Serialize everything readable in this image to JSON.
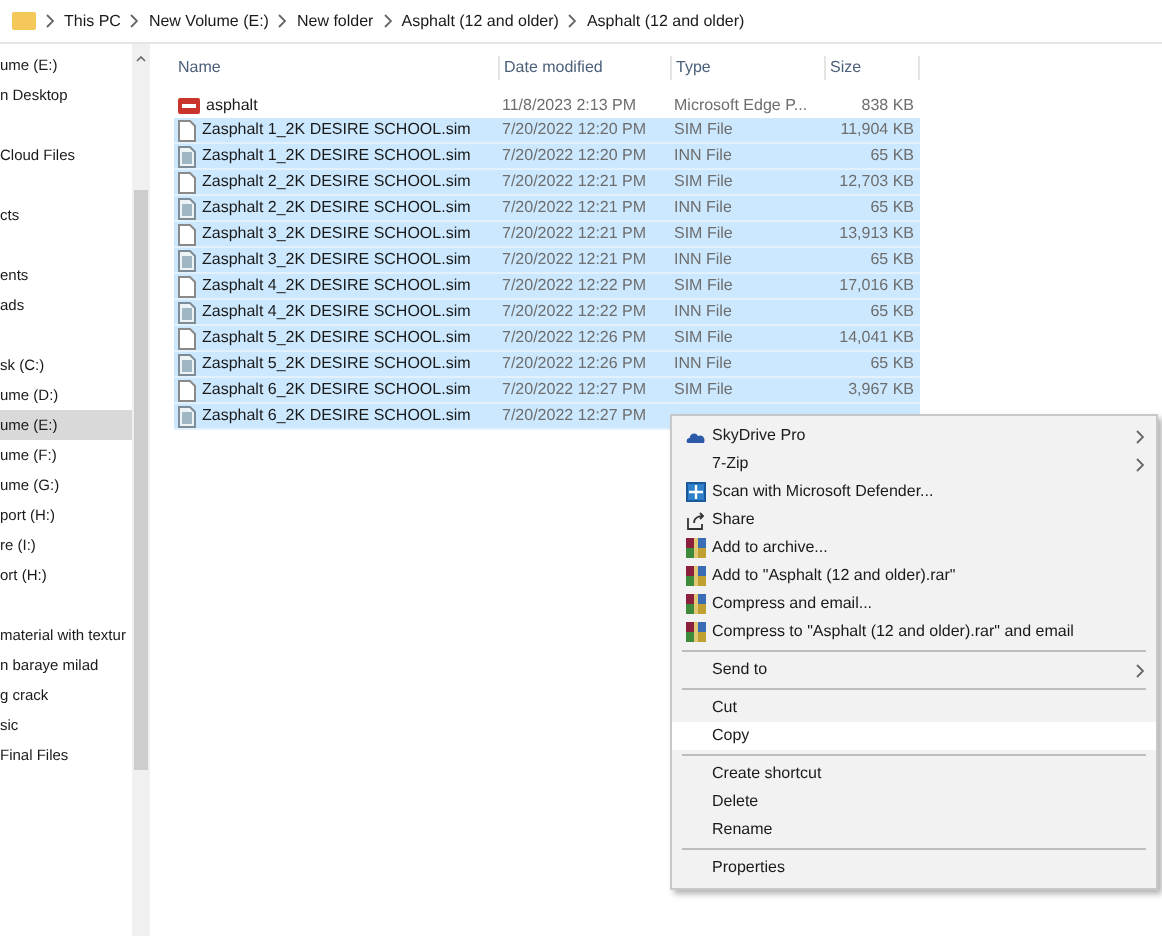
{
  "breadcrumb": [
    "This PC",
    "New Volume (E:)",
    "New folder",
    "Asphalt (12 and older)",
    "Asphalt (12 and older)"
  ],
  "sidebar": {
    "items": [
      {
        "label": "ume (E:)",
        "selected": false,
        "gap": false
      },
      {
        "label": "n Desktop",
        "selected": false,
        "gap": false
      },
      {
        "label": "Cloud Files",
        "selected": false,
        "gap": true
      },
      {
        "label": "cts",
        "selected": false,
        "gap": true
      },
      {
        "label": "ents",
        "selected": false,
        "gap": true
      },
      {
        "label": "ads",
        "selected": false,
        "gap": false
      },
      {
        "label": "sk (C:)",
        "selected": false,
        "gap": true
      },
      {
        "label": "ume (D:)",
        "selected": false,
        "gap": false
      },
      {
        "label": "ume (E:)",
        "selected": true,
        "gap": false
      },
      {
        "label": "ume (F:)",
        "selected": false,
        "gap": false
      },
      {
        "label": "ume (G:)",
        "selected": false,
        "gap": false
      },
      {
        "label": "port (H:)",
        "selected": false,
        "gap": false
      },
      {
        "label": "re (I:)",
        "selected": false,
        "gap": false
      },
      {
        "label": "ort (H:)",
        "selected": false,
        "gap": false
      },
      {
        "label": "material with textur",
        "selected": false,
        "gap": true
      },
      {
        "label": "n baraye milad",
        "selected": false,
        "gap": false
      },
      {
        "label": "g crack",
        "selected": false,
        "gap": false
      },
      {
        "label": "sic",
        "selected": false,
        "gap": false
      },
      {
        "label": "Final Files",
        "selected": false,
        "gap": false
      }
    ]
  },
  "table": {
    "columns": [
      "Name",
      "Date modified",
      "Type",
      "Size"
    ],
    "rows": [
      {
        "kind": "pdf",
        "name": "asphalt",
        "date": "11/8/2023 2:13 PM",
        "type": "Microsoft Edge P...",
        "size": "838 KB",
        "selected": false
      },
      {
        "kind": "sim",
        "name": "Zasphalt 1_2K DESIRE SCHOOL.sim",
        "date": "7/20/2022 12:20 PM",
        "type": "SIM File",
        "size": "11,904 KB",
        "selected": true
      },
      {
        "kind": "inn",
        "name": "Zasphalt 1_2K DESIRE SCHOOL.sim",
        "date": "7/20/2022 12:20 PM",
        "type": "INN File",
        "size": "65 KB",
        "selected": true
      },
      {
        "kind": "sim",
        "name": "Zasphalt 2_2K DESIRE SCHOOL.sim",
        "date": "7/20/2022 12:21 PM",
        "type": "SIM File",
        "size": "12,703 KB",
        "selected": true
      },
      {
        "kind": "inn",
        "name": "Zasphalt 2_2K DESIRE SCHOOL.sim",
        "date": "7/20/2022 12:21 PM",
        "type": "INN File",
        "size": "65 KB",
        "selected": true
      },
      {
        "kind": "sim",
        "name": "Zasphalt 3_2K DESIRE SCHOOL.sim",
        "date": "7/20/2022 12:21 PM",
        "type": "SIM File",
        "size": "13,913 KB",
        "selected": true
      },
      {
        "kind": "inn",
        "name": "Zasphalt 3_2K DESIRE SCHOOL.sim",
        "date": "7/20/2022 12:21 PM",
        "type": "INN File",
        "size": "65 KB",
        "selected": true
      },
      {
        "kind": "sim",
        "name": "Zasphalt 4_2K DESIRE SCHOOL.sim",
        "date": "7/20/2022 12:22 PM",
        "type": "SIM File",
        "size": "17,016 KB",
        "selected": true
      },
      {
        "kind": "inn",
        "name": "Zasphalt 4_2K DESIRE SCHOOL.sim",
        "date": "7/20/2022 12:22 PM",
        "type": "INN File",
        "size": "65 KB",
        "selected": true
      },
      {
        "kind": "sim",
        "name": "Zasphalt 5_2K DESIRE SCHOOL.sim",
        "date": "7/20/2022 12:26 PM",
        "type": "SIM File",
        "size": "14,041 KB",
        "selected": true
      },
      {
        "kind": "inn",
        "name": "Zasphalt 5_2K DESIRE SCHOOL.sim",
        "date": "7/20/2022 12:26 PM",
        "type": "INN File",
        "size": "65 KB",
        "selected": true
      },
      {
        "kind": "sim",
        "name": "Zasphalt 6_2K DESIRE SCHOOL.sim",
        "date": "7/20/2022 12:27 PM",
        "type": "SIM File",
        "size": "3,967 KB",
        "selected": true
      },
      {
        "kind": "inn",
        "name": "Zasphalt 6_2K DESIRE SCHOOL.sim",
        "date": "7/20/2022 12:27 PM",
        "selected": true
      }
    ]
  },
  "context_menu": {
    "items": [
      {
        "kind": "cloud",
        "label": "SkyDrive Pro",
        "submenu": true,
        "selected": false
      },
      {
        "kind": "plain",
        "label": "7-Zip",
        "submenu": true,
        "selected": false
      },
      {
        "kind": "shield",
        "label": "Scan with Microsoft Defender...",
        "submenu": false,
        "selected": false
      },
      {
        "kind": "share",
        "label": "Share",
        "submenu": false,
        "selected": false
      },
      {
        "kind": "archive",
        "label": "Add to archive...",
        "submenu": false,
        "selected": false
      },
      {
        "kind": "archive",
        "label": "Add to \"Asphalt (12 and older).rar\"",
        "submenu": false,
        "selected": false
      },
      {
        "kind": "archive",
        "label": "Compress and email...",
        "submenu": false,
        "selected": false
      },
      {
        "kind": "archive",
        "label": "Compress to \"Asphalt (12 and older).rar\" and email",
        "submenu": false,
        "selected": false
      },
      {
        "kind": "separator"
      },
      {
        "kind": "plain",
        "label": "Send to",
        "submenu": true,
        "selected": false
      },
      {
        "kind": "separator"
      },
      {
        "kind": "plain",
        "label": "Cut",
        "submenu": false,
        "selected": false
      },
      {
        "kind": "plain",
        "label": "Copy",
        "submenu": false,
        "selected": true
      },
      {
        "kind": "separator"
      },
      {
        "kind": "plain",
        "label": "Create shortcut",
        "submenu": false,
        "selected": false
      },
      {
        "kind": "plain",
        "label": "Delete",
        "submenu": false,
        "selected": false
      },
      {
        "kind": "plain",
        "label": "Rename",
        "submenu": false,
        "selected": false
      },
      {
        "kind": "separator"
      },
      {
        "kind": "plain",
        "label": "Properties",
        "submenu": false,
        "selected": false
      }
    ]
  }
}
